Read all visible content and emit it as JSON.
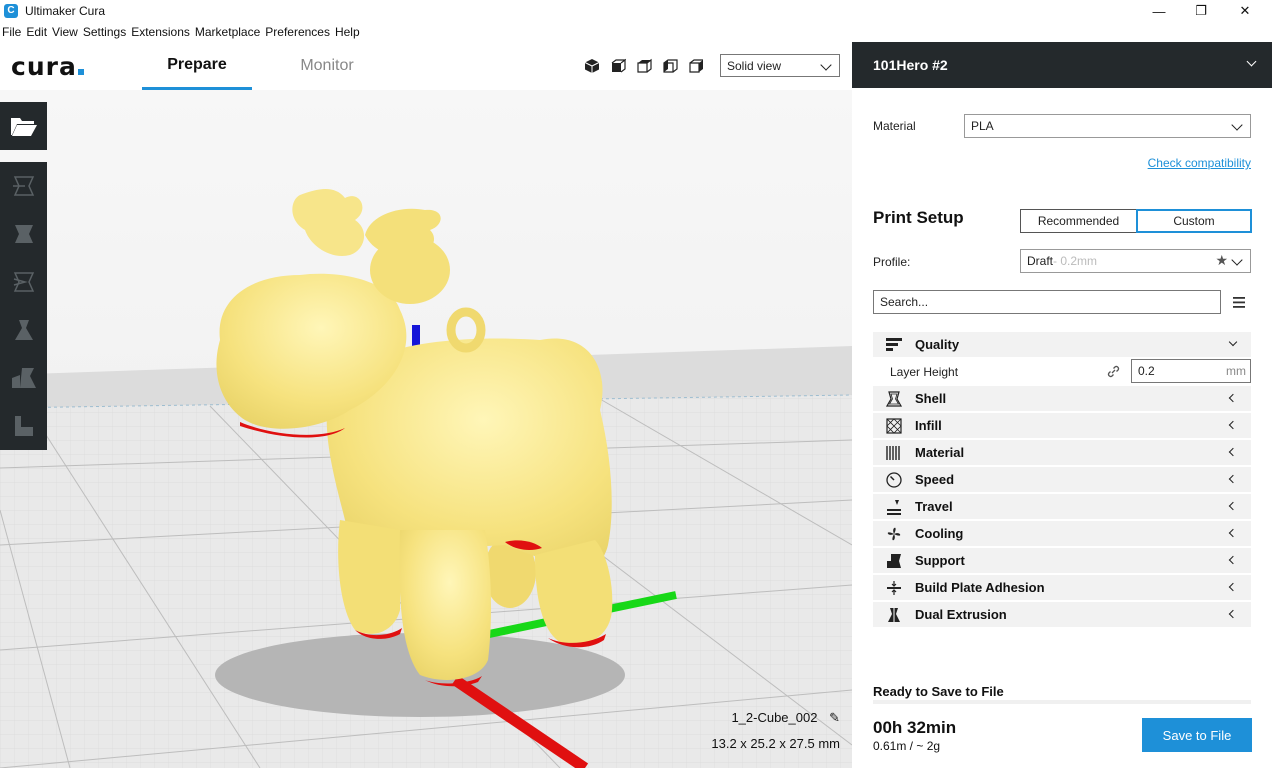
{
  "window": {
    "title": "Ultimaker Cura",
    "minimize": "—",
    "maximize": "❐",
    "close": "✕"
  },
  "menu": [
    "File",
    "Edit",
    "View",
    "Settings",
    "Extensions",
    "Marketplace",
    "Preferences",
    "Help"
  ],
  "header": {
    "logo": "cura",
    "tabs": [
      {
        "label": "Prepare",
        "active": true
      },
      {
        "label": "Monitor",
        "active": false
      }
    ],
    "view_select": "Solid view"
  },
  "object": {
    "name": "1_2-Cube_002",
    "dimensions": "13.2 x 25.2 x 27.5 mm"
  },
  "printer": {
    "name": "101Hero #2"
  },
  "material": {
    "label": "Material",
    "value": "PLA",
    "link": "Check compatibility"
  },
  "print_setup": {
    "title": "Print Setup",
    "mode_recommended": "Recommended",
    "mode_custom": "Custom",
    "profile_label": "Profile:",
    "profile_name": "Draft",
    "profile_detail": " - 0.2mm",
    "search_placeholder": "Search...",
    "quality_label": "Quality",
    "layer_height_label": "Layer Height",
    "layer_height_value": "0.2",
    "layer_height_unit": "mm",
    "categories": [
      "Shell",
      "Infill",
      "Material",
      "Speed",
      "Travel",
      "Cooling",
      "Support",
      "Build Plate Adhesion",
      "Dual Extrusion"
    ]
  },
  "output": {
    "status": "Ready to Save to File",
    "time": "00h 32min",
    "usage": "0.61m / ~ 2g",
    "save_label": "Save to File"
  },
  "colors": {
    "accent": "#1e90d8",
    "dark": "#24292c",
    "model": "#f7e88a"
  }
}
